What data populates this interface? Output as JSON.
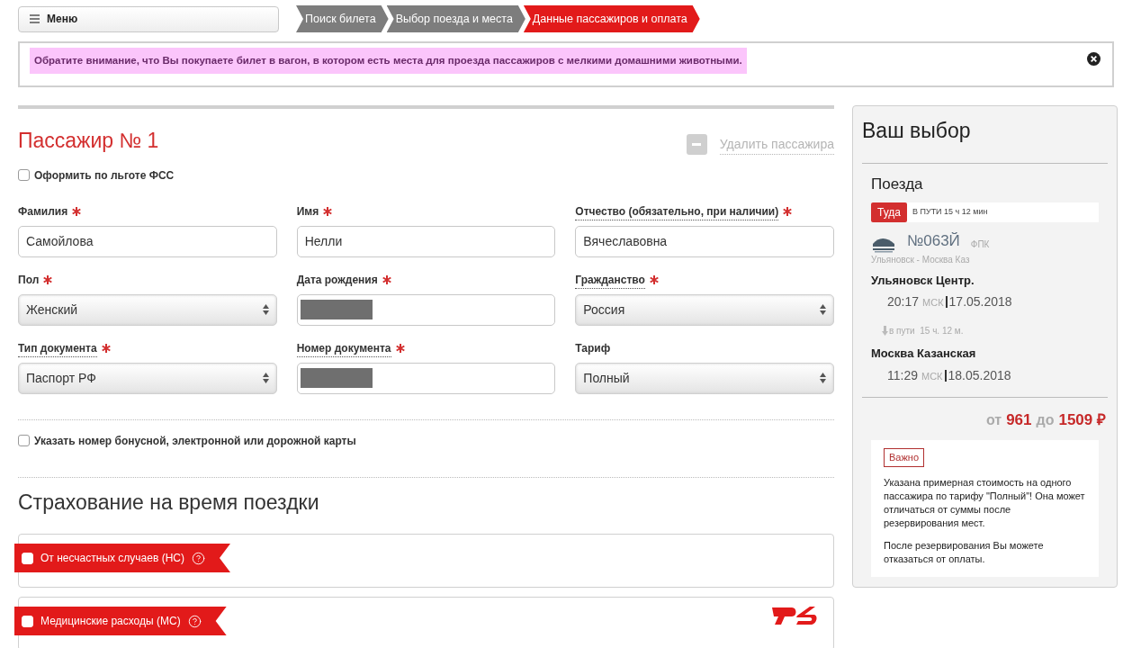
{
  "menu_button": {
    "label": "Меню"
  },
  "steps": [
    {
      "label": "Поиск билета",
      "selected": false
    },
    {
      "label": "Выбор поезда и места",
      "selected": false
    },
    {
      "label": "Данные пассажиров и оплата",
      "selected": true
    }
  ],
  "notice": {
    "text": "Обратите внимание, что Вы покупаете билет в вагон, в котором есть места для проезда пассажиров с мелкими домашними животными."
  },
  "passenger": {
    "title": "Пассажир № 1",
    "remove_link": "Удалить пассажира",
    "benefit_checkbox": {
      "label": "Оформить по льготе ФСС",
      "checked": false
    },
    "fields": [
      {
        "label": "Фамилия",
        "required": true,
        "dotted": false,
        "kind": "text",
        "value": "Самойлова"
      },
      {
        "label": "Имя",
        "required": true,
        "dotted": false,
        "kind": "text",
        "value": "Нелли"
      },
      {
        "label": "Отчество (обязательно, при наличии)",
        "required": true,
        "dotted": true,
        "kind": "text",
        "value": "Вячеславовна"
      },
      {
        "label": "Пол",
        "required": true,
        "dotted": false,
        "kind": "select",
        "value": "Женский"
      },
      {
        "label": "Дата рождения",
        "required": true,
        "dotted": false,
        "kind": "redacted"
      },
      {
        "label": "Гражданство",
        "required": true,
        "dotted": true,
        "kind": "select",
        "value": "Россия"
      },
      {
        "label": "Тип документа",
        "required": true,
        "dotted": true,
        "kind": "select",
        "value": "Паспорт РФ"
      },
      {
        "label": "Номер документа",
        "required": true,
        "dotted": true,
        "kind": "redacted"
      },
      {
        "label": "Тариф",
        "required": false,
        "dotted": false,
        "kind": "select",
        "value": "Полный"
      }
    ],
    "card_checkbox": {
      "label": "Указать номер бонусной, электронной или дорожной карты",
      "checked": false
    }
  },
  "insurance": {
    "title": "Страхование на время поездки",
    "options": [
      {
        "label": "От несчастных случаев (НС)",
        "checked": false,
        "logo": false
      },
      {
        "label": "Медицинские расходы (МС)",
        "checked": false,
        "logo": true
      }
    ]
  },
  "summary": {
    "title": "Ваш выбор",
    "section": "Поезда",
    "direction": "Туда",
    "travel_time": "В ПУТИ 15 ч 12 мин",
    "train_number": "№063Й",
    "carrier": "ФПК",
    "route": "Ульяновск - Москва Каз",
    "departure": {
      "station": "Ульяновск Центр.",
      "time": "20:17",
      "zone": "МСК",
      "date": "17.05.2018"
    },
    "duration": "в пути  15 ч. 12 м.",
    "arrival": {
      "station": "Москва Казанская",
      "time": "11:29",
      "zone": "МСК",
      "date": "18.05.2018"
    },
    "price": {
      "from_word": "от",
      "from": "961",
      "to_word": "до",
      "to": "1509 ₽"
    },
    "important": {
      "badge": "Важно",
      "paragraphs": [
        "Указана примерная стоимость на одного пассажира по тарифу \"Полный\"! Она может отличаться от суммы после резервирования мест.",
        "После резервирования Вы можете отказаться от оплаты."
      ]
    }
  }
}
